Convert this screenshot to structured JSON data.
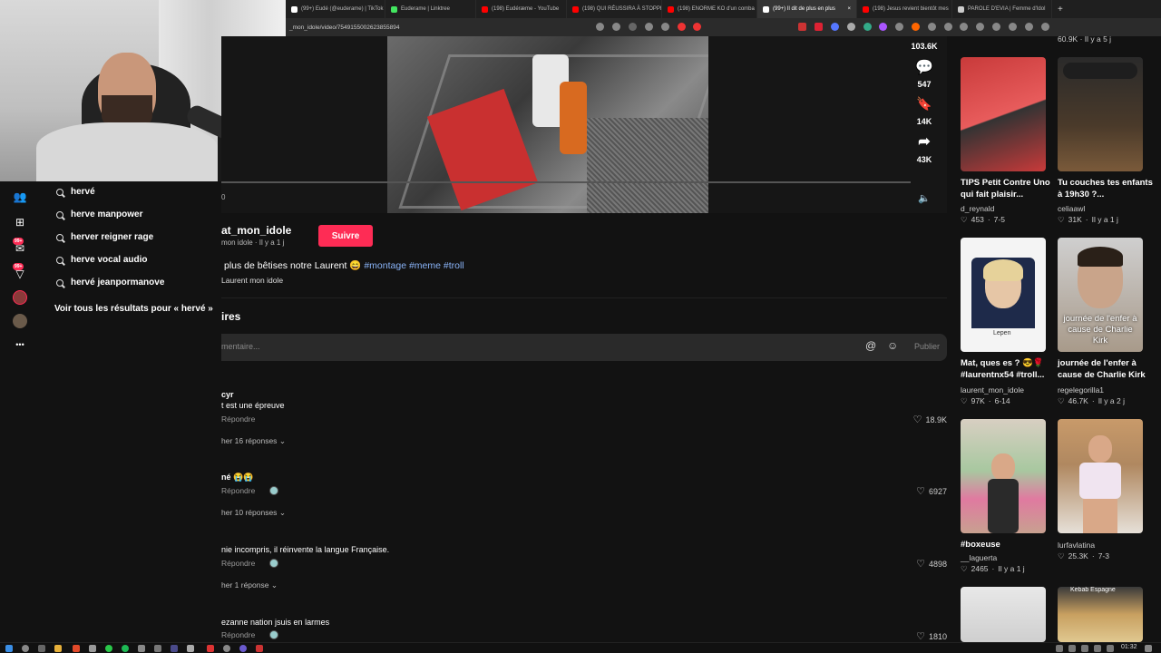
{
  "browser": {
    "tabs": [
      {
        "label": "(99+) Eudé (@euderame) | TikTok",
        "fav": "#ffffff",
        "active": false
      },
      {
        "label": "Euderame | Linktree",
        "fav": "#43e660",
        "active": false
      },
      {
        "label": "(198) Eudéræme - YouTube",
        "fav": "#ff0000",
        "active": false
      },
      {
        "label": "(198) QUI RÉUSSIRA À STOPPER",
        "fav": "#ff0000",
        "active": false
      },
      {
        "label": "(198) ENORME KO d'un comba",
        "fav": "#ff0000",
        "active": false
      },
      {
        "label": "(99+) Il dit de plus en plus",
        "fav": "#ffffff",
        "active": true
      },
      {
        "label": "(198) Jesus revient bientôt mes",
        "fav": "#ff0000",
        "active": false
      },
      {
        "label": "PAROLE D'EVIA | Femme d'Idol",
        "fav": "#cccccc",
        "active": false
      }
    ],
    "new_tab": "+",
    "url": "_mon_idole/video/7549155002623855894"
  },
  "rail": {
    "badge1": "99+",
    "badge2": "99+",
    "more": "•••"
  },
  "search_dropdown": {
    "suggestions": [
      "hervé",
      "herve manpower",
      "herver reigner rage",
      "herve vocal audio",
      "hervé jeanpormanove"
    ],
    "see_all": "Voir tous les résultats pour « hervé »"
  },
  "video": {
    "time_left": "0",
    "actions": {
      "likes": "103.6K",
      "comments": "547",
      "saves": "14K",
      "shares": "43K"
    }
  },
  "post": {
    "author": "at_mon_idole",
    "sub": "mon idole · Il y a 1 j",
    "follow": "Suivre",
    "caption": "plus de bêtises notre Laurent 😄",
    "hashtags": "#montage #meme #troll",
    "music": "Laurent mon idole"
  },
  "comments": {
    "header": "ires",
    "placeholder": "mentaire...",
    "post_button": "Publier",
    "items": [
      {
        "user": "cyr",
        "text": "t est une épreuve",
        "reply": "Répondre",
        "replies": "her 16 réponses",
        "likes": "18.9K"
      },
      {
        "user": "né 😭😭",
        "text": "",
        "reply": "Répondre",
        "replies": "her 10 réponses",
        "likes": "6927"
      },
      {
        "user": "",
        "text": "nie incompris, il réinvente la langue Française.",
        "reply": "Répondre",
        "replies": "her 1 réponse",
        "likes": "4898"
      },
      {
        "user": "",
        "text": "ezanne nation jsuis en larmes",
        "reply": "Répondre",
        "replies": "",
        "likes": "1810"
      }
    ]
  },
  "recommended": {
    "top_meta": "60.9K · Il y a 5 j",
    "cards": [
      {
        "title": "TIPS Petit Contre Uno qui fait plaisir...",
        "user": "d_reynald",
        "views": "453",
        "age": "7-5"
      },
      {
        "title": "Tu couches tes enfants à 19h30 ?...",
        "user": "celiaawl",
        "views": "31K",
        "age": "Il y a 1 j"
      },
      {
        "title": "Mat, ques es ? 😎🌹 #laurentnx54 #troll...",
        "user": "laurent_mon_idole",
        "views": "97K",
        "age": "6-14",
        "overlay": "Lepen"
      },
      {
        "title": "journée de l'enfer à cause de Charlie Kirk",
        "user": "regelegorilla1",
        "views": "46.7K",
        "age": "Il y a 2 j",
        "overlay": "journée de l'enfer à cause de Charlie Kirk"
      },
      {
        "title": "#boxeuse",
        "user": "__laguerta",
        "views": "2465",
        "age": "Il y a 1 j"
      },
      {
        "title": "",
        "user": "lurfavlatina",
        "views": "25.3K",
        "age": "7-3"
      },
      {
        "title": "",
        "user": "",
        "views": "",
        "age": ""
      },
      {
        "title": "",
        "user": "",
        "views": "",
        "age": "",
        "overlay": "Kebab Espagne"
      }
    ]
  },
  "taskbar": {
    "time": "01:32"
  },
  "colors": {
    "accent": "#fe2c55",
    "hashtag": "#8ab4f8",
    "bg": "#121212"
  }
}
